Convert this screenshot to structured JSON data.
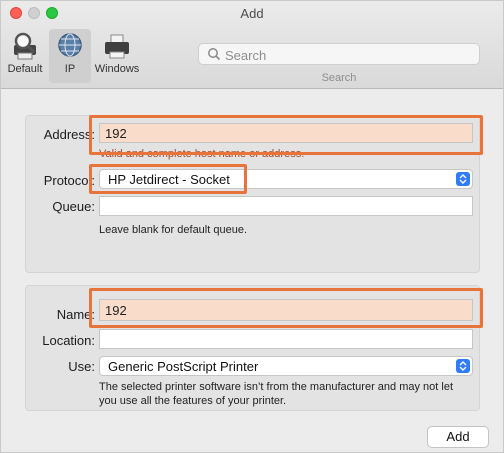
{
  "window": {
    "title": "Add"
  },
  "toolbar": {
    "items": [
      {
        "label": "Default",
        "icon": "magnifier-printer-icon"
      },
      {
        "label": "IP",
        "icon": "globe-icon"
      },
      {
        "label": "Windows",
        "icon": "printer-icon"
      }
    ],
    "search": {
      "placeholder": "Search",
      "caption": "Search"
    }
  },
  "ip_form": {
    "address_label": "Address:",
    "address_value": "192",
    "address_hint": "Valid and complete host name or address.",
    "protocol_label": "Protocol:",
    "protocol_value": "HP Jetdirect - Socket",
    "queue_label": "Queue:",
    "queue_value": "",
    "queue_hint": "Leave blank for default queue."
  },
  "printer_form": {
    "name_label": "Name:",
    "name_value": "192",
    "location_label": "Location:",
    "location_value": "",
    "use_label": "Use:",
    "use_value": "Generic PostScript Printer",
    "use_note": "The selected printer software isn’t from the manufacturer and may not let you use all the features of your printer."
  },
  "footer": {
    "add_label": "Add"
  },
  "colors": {
    "highlight_fill": "#fadccb",
    "annotation": "#e8743b",
    "accent": "#2f7cf6"
  }
}
